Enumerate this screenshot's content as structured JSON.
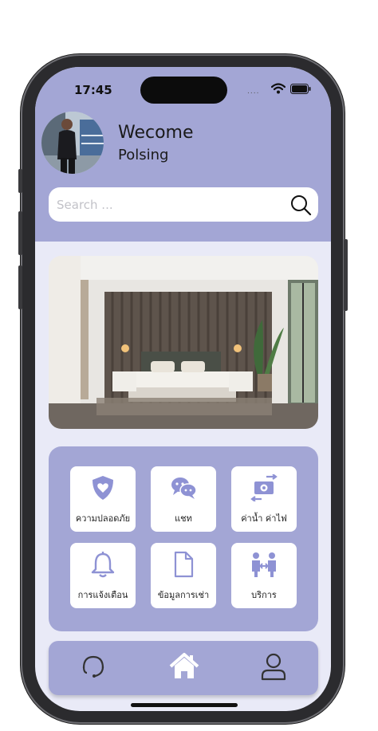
{
  "status_bar": {
    "time": "17:45",
    "signal": "....",
    "icons": [
      "wifi-icon",
      "battery-icon"
    ]
  },
  "header": {
    "title": "Wecome",
    "user_name": "Polsing",
    "avatar": "avatar"
  },
  "search": {
    "placeholder": "Search ...",
    "value": ""
  },
  "hero": {
    "image": "bedroom-photo"
  },
  "menu": {
    "items": [
      {
        "label": "ความปลอดภัย",
        "icon": "shield-heart-icon"
      },
      {
        "label": "แชท",
        "icon": "chat-icon"
      },
      {
        "label": "ค่าน้ำ ค่าไฟ",
        "icon": "money-exchange-icon"
      },
      {
        "label": "การแจ้งเตือน",
        "icon": "bell-icon"
      },
      {
        "label": "ข้อมูลการเช่า",
        "icon": "document-icon"
      },
      {
        "label": "บริการ",
        "icon": "service-people-icon"
      }
    ]
  },
  "bottom_nav": {
    "items": [
      {
        "icon": "headset-icon"
      },
      {
        "icon": "home-icon"
      },
      {
        "icon": "user-icon"
      }
    ]
  },
  "colors": {
    "header_bg": "#a3a6d5",
    "screen_bg": "#e9eaf7",
    "accent": "#8e92d4",
    "card_bg": "#ffffff"
  }
}
